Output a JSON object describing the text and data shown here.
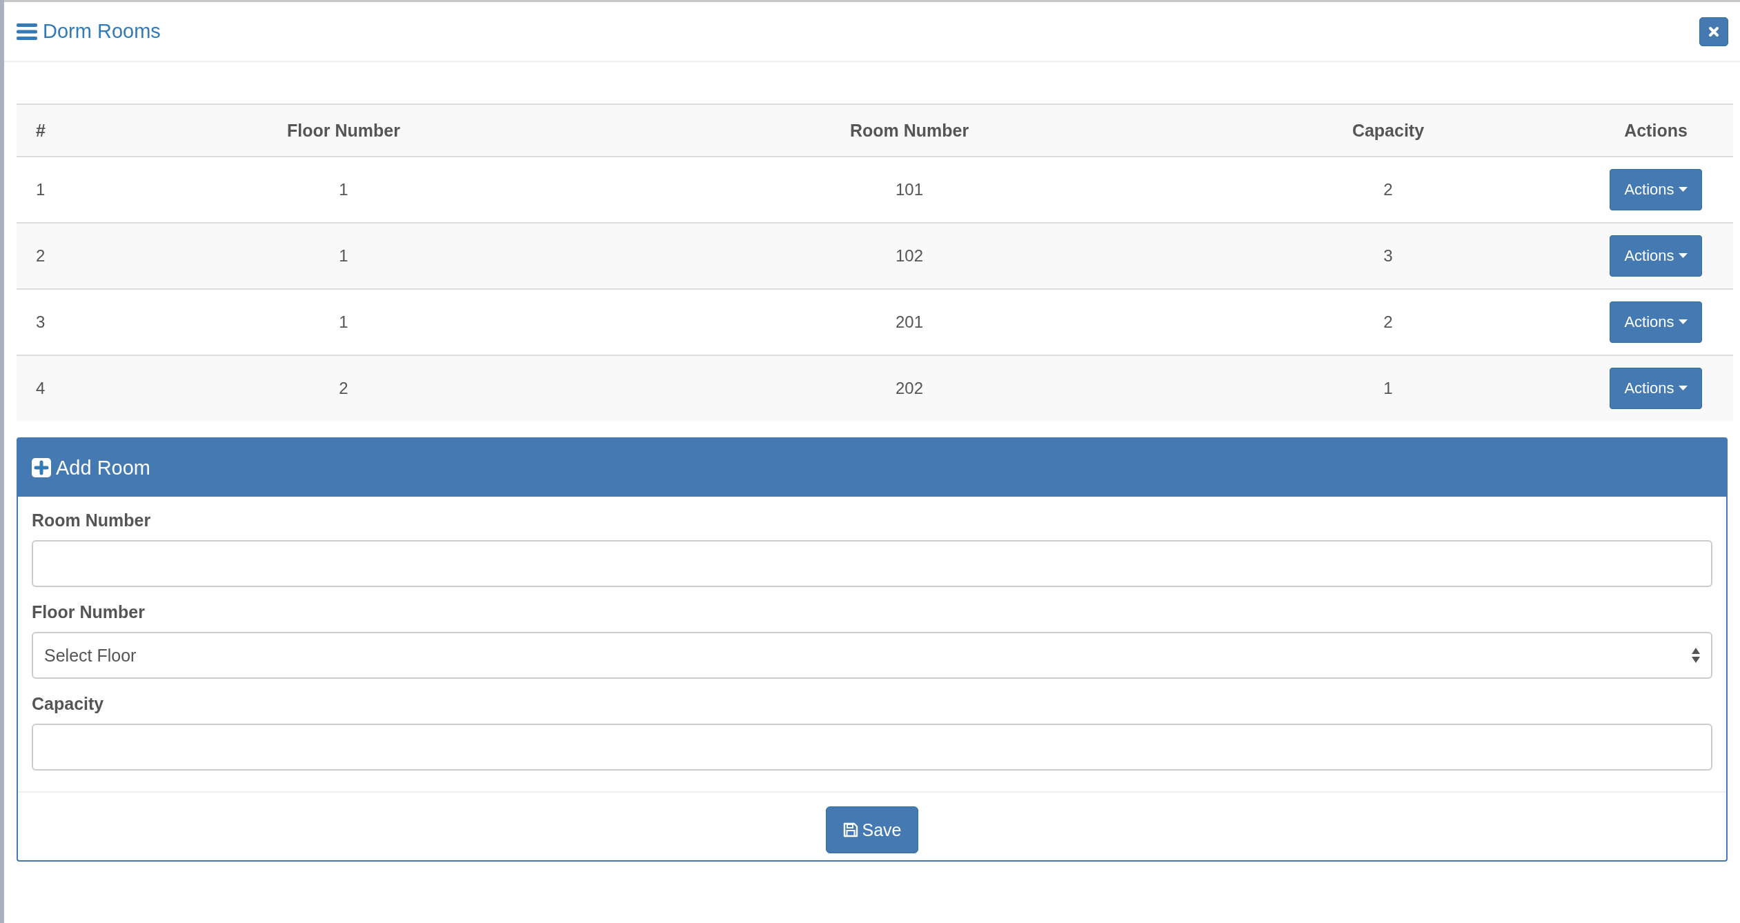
{
  "modal": {
    "title": "Dorm Rooms"
  },
  "table": {
    "columns": [
      "#",
      "Floor Number",
      "Room Number",
      "Capacity",
      "Actions"
    ],
    "rows": [
      {
        "cells": [
          "1",
          "1",
          "101",
          "2"
        ],
        "action": "Actions"
      },
      {
        "cells": [
          "2",
          "1",
          "102",
          "3"
        ],
        "action": "Actions"
      },
      {
        "cells": [
          "3",
          "1",
          "201",
          "2"
        ],
        "action": "Actions"
      },
      {
        "cells": [
          "4",
          "2",
          "202",
          "1"
        ],
        "action": "Actions"
      }
    ]
  },
  "form": {
    "title": "Add Room",
    "fields": [
      {
        "kind": "text",
        "label": "Room Number"
      },
      {
        "kind": "select",
        "label": "Floor Number",
        "value": "Select Floor"
      },
      {
        "kind": "text",
        "label": "Capacity"
      }
    ],
    "submit": "Save"
  }
}
